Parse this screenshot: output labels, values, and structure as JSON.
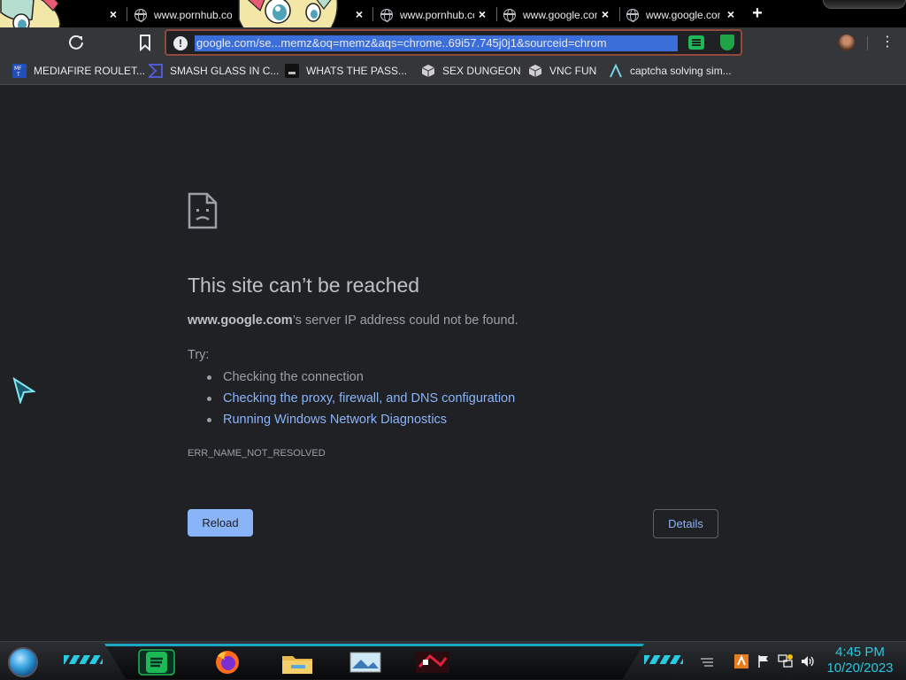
{
  "tabs": [
    {
      "title": "",
      "close": "×"
    },
    {
      "title": "www.pornhub.com",
      "close": "×"
    },
    {
      "title": "www.pornhub.com",
      "close": "×"
    },
    {
      "title": "www.google.com",
      "close": "×"
    },
    {
      "title": "www.google.com",
      "close": "×"
    }
  ],
  "new_tab": "+",
  "toolbar": {
    "url": "google.com/se...memz&oq=memz&aqs=chrome..69i57.745j0j1&sourceid=chrom",
    "info": "!",
    "menu": "⋮"
  },
  "bookmarks": [
    {
      "label": "MEDIAFIRE ROULET...",
      "icon": "mediafire-icon"
    },
    {
      "label": "SMASH GLASS IN C...",
      "icon": "chevron-icon"
    },
    {
      "label": "WHATS THE PASS...",
      "icon": "terminal-icon"
    },
    {
      "label": "SEX DUNGEON",
      "icon": "cube-icon"
    },
    {
      "label": "VNC FUN",
      "icon": "cube-icon"
    },
    {
      "label": "captcha solving sim...",
      "icon": "lambda-icon"
    }
  ],
  "error": {
    "title": "This site can’t be reached",
    "host": "www.google.com",
    "message_rest": "’s server IP address could not be found.",
    "try_label": "Try:",
    "suggestions": [
      "Checking the connection",
      "Checking the proxy, firewall, and DNS configuration",
      "Running Windows Network Diagnostics"
    ],
    "code": "ERR_NAME_NOT_RESOLVED",
    "reload_label": "Reload",
    "details_label": "Details"
  },
  "clock": {
    "time": "4:45 PM",
    "date": "10/20/2023"
  },
  "colors": {
    "link": "#8ab4f8",
    "accent": "#29c9e3",
    "page_bg": "#202124"
  }
}
